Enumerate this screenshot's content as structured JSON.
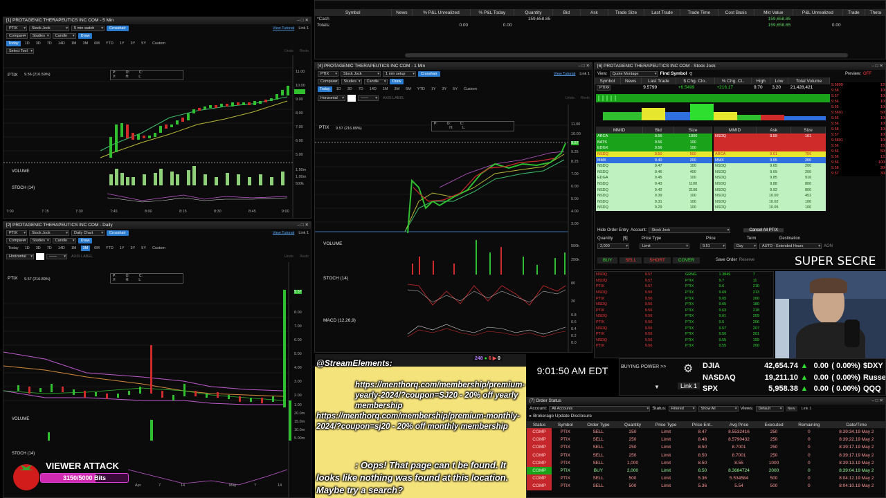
{
  "w1": {
    "title": "[1] PROTAGENIC THERAPEUTICS INC COM - 5 Min",
    "symbol": "PTIX",
    "layout": "Stock Jock",
    "interval": "5 min watch",
    "crosshair": "Crosshair",
    "tutorial": "View Tutorial",
    "link": "Link 1",
    "compare": "Compare",
    "studies": "Studies",
    "candle": "Candle",
    "draw": "Draw",
    "periods": [
      "Today",
      "1D",
      "3D",
      "7D",
      "14D",
      "1M",
      "3M",
      "6M",
      "YTD",
      "1Y",
      "3Y",
      "5Y",
      "Custom"
    ],
    "tool": "Select Tool",
    "undo": "Undo",
    "redo": "Redo",
    "price_label": "PTIX",
    "price_tag": "9.56 (216.59%)",
    "ohlc": [
      "P:",
      "O:",
      "C:",
      "V:",
      "H:",
      "L:"
    ],
    "volume": "VOLUME",
    "stoch": "STOCH (14)",
    "xticks": [
      "7:00",
      "7:15",
      "7:30",
      "7:45",
      "8:00",
      "8:15",
      "8:30",
      "8:45",
      "9:00"
    ],
    "yticks": [
      "11.00",
      "10.00",
      "9.00",
      "8.00",
      "7.00",
      "6.00",
      "5.00",
      "4.00",
      "3.00"
    ],
    "vticks": [
      "1.50m",
      "1.00m",
      "500k"
    ]
  },
  "w2": {
    "title": "[2] PROTAGENIC THERAPEUTICS INC COM - Daily",
    "symbol": "PTIX",
    "layout": "Stock Jock",
    "interval": "Daily Chart",
    "crosshair": "Crosshair",
    "tutorial": "View Tutorial",
    "link": "Link 1",
    "compare": "Compare",
    "studies": "Studies",
    "candle": "Candle",
    "draw": "Draw",
    "periods": [
      "Today",
      "1D",
      "3D",
      "7D",
      "14D",
      "1M",
      "3M",
      "6M",
      "YTD",
      "1Y",
      "3Y",
      "5Y",
      "Custom"
    ],
    "tool": "Horizontal",
    "axis": "AXIS LABEL",
    "undo": "Undo",
    "redo": "Redo",
    "price_label": "PTIX",
    "price_tag": "9.57 (216.89%)",
    "ohlc": [
      "P:",
      "O:",
      "C:",
      "V:",
      "H:",
      "L:"
    ],
    "volume": "VOLUME",
    "stoch": "STOCH (14)",
    "xticks": [
      "Apr",
      "7",
      "14",
      "May",
      "7",
      "14"
    ],
    "yticks": [
      "9.57",
      "8.00",
      "7.00",
      "6.00",
      "5.00",
      "4.00",
      "3.00",
      "2.00",
      "1.00"
    ],
    "vticks": [
      "20.0m",
      "15.0m",
      "10.0m",
      "5.00m"
    ]
  },
  "w4": {
    "title": "[4] PROTAGENIC THERAPEUTICS INC COM - 1 Min",
    "symbol": "PTIX",
    "layout": "Stock Jock",
    "interval": "1 min setup",
    "crosshair": "Crosshair",
    "tutorial": "View Tutorial",
    "link": "Link 1",
    "compare": "Compare",
    "studies": "Studies",
    "candle": "Candle",
    "draw": "Draw",
    "periods": [
      "Today",
      "1D",
      "3D",
      "7D",
      "14D",
      "1M",
      "3M",
      "6M",
      "YTD",
      "1Y",
      "3Y",
      "5Y",
      "Custom"
    ],
    "tool": "Horizontal",
    "axis": "AXIS LABEL",
    "undo": "Undo",
    "redo": "Redo",
    "price_label": "PTIX",
    "price_tag": "9.57 (216.89%)",
    "ohlc": [
      "P:",
      "O:",
      "C:",
      "H:",
      "L:"
    ],
    "volume": "VOLUME",
    "stoch": "STOCH (14)",
    "macd": "MACD (12,26,9)",
    "yticks": [
      "11.00",
      "10.00",
      "9.57",
      "9.25",
      "8.25",
      "7.00",
      "6.00",
      "5.00",
      "4.00",
      "3.00"
    ],
    "vticks": [
      "500k",
      "250k"
    ],
    "sticks": [
      "80",
      "20"
    ],
    "mticks": [
      "0.8",
      "0.6",
      "0.4",
      "0.2",
      "0.0"
    ]
  },
  "portfolio": {
    "headers": [
      "Symbol",
      "News",
      "% P&L Unrealized",
      "% P&L Today",
      "Quantity",
      "Bid",
      "Ask",
      "Trade Size",
      "Last Trade",
      "Trade Time",
      "Cost Basis",
      "Mkt Value",
      "P&L Unrealized",
      "Trade",
      "Theta"
    ],
    "rows": [
      [
        "*Cash",
        "",
        "",
        "",
        "159,658.85",
        "",
        "",
        "",
        "",
        "",
        "",
        "159,658.85",
        "",
        "",
        ""
      ],
      [
        "Totals:",
        "",
        "0.00",
        "0.00",
        "",
        "",
        "",
        "",
        "",
        "",
        "",
        "159,658.85",
        "0.00",
        "",
        ""
      ]
    ]
  },
  "quote": {
    "title": "[6] PROTAGENIC THERAPEUTICS INC COM - Stock Jock",
    "view": "View:",
    "montage": "Quote Montage",
    "find": "Find Symbol",
    "preview": "Preview:",
    "preview_state": "OFF",
    "headers": [
      "Symbol",
      "News",
      "Last Trade",
      "$ Chg. Clo..",
      "% Chg. Cl..",
      "High",
      "Low",
      "Total Volume"
    ],
    "row": [
      "PTIX",
      "",
      "9.5799",
      "+6.5499",
      "+216.17",
      "9.70",
      "3.20",
      "21,428,421"
    ]
  },
  "level2": {
    "bid_headers": [
      "MMID",
      "Bid",
      "Size"
    ],
    "ask_headers": [
      "MMID",
      "Ask",
      "Size"
    ],
    "bids": [
      [
        "ARCA",
        "9.56",
        "1800"
      ],
      [
        "BATS",
        "9.56",
        "100"
      ],
      [
        "EDGX",
        "9.56",
        "100"
      ],
      [
        "NSDQ",
        "9.50",
        "500"
      ],
      [
        "MMX",
        "9.40",
        "200"
      ],
      [
        "NSDQ",
        "9.47",
        "100"
      ],
      [
        "NSDQ",
        "9.46",
        "400"
      ],
      [
        "EDGA",
        "9.45",
        "100"
      ],
      [
        "NSDQ",
        "9.43",
        "1100"
      ],
      [
        "NSDQ",
        "9.42",
        "2100"
      ],
      [
        "NSDQ",
        "9.39",
        "100"
      ],
      [
        "NSDQ",
        "9.31",
        "100"
      ],
      [
        "NSDQ",
        "9.29",
        "100"
      ]
    ],
    "asks": [
      [
        "NSDQ",
        "9.59",
        "161"
      ],
      [
        "",
        "",
        ""
      ],
      [
        "",
        "",
        ""
      ],
      [
        "ARCA",
        "9.61",
        "700"
      ],
      [
        "MMX",
        "9.65",
        "200"
      ],
      [
        "NSDQ",
        "9.65",
        "200"
      ],
      [
        "NSDQ",
        "9.69",
        "200"
      ],
      [
        "NSDQ",
        "9.85",
        "916"
      ],
      [
        "NSDQ",
        "9.88",
        "800"
      ],
      [
        "NSDQ",
        "9.92",
        "800"
      ],
      [
        "NSDQ",
        "10.00",
        "452"
      ],
      [
        "NSDQ",
        "10.02",
        "100"
      ],
      [
        "NSDQ",
        "10.05",
        "100"
      ]
    ],
    "right_prices": [
      "9.5899",
      "9.58",
      "9.57",
      "9.56",
      "9.55",
      "9.5601",
      "9.56",
      "9.56",
      "9.58",
      "9.57",
      "9.5801",
      "9.56",
      "9.56",
      "9.56",
      "9.56",
      "9.58",
      "9.57"
    ],
    "right_sizes": [
      "120",
      "100",
      "100",
      "100",
      "100",
      "500",
      "100",
      "100",
      "100",
      "100",
      "100",
      "150",
      "500",
      "131",
      "1000",
      "300",
      "300"
    ]
  },
  "order_entry": {
    "hide": "Hide Order Entry",
    "account_label": "Account:",
    "account": "Stock Jock",
    "cancel": "Cancel All PTIX",
    "labels": [
      "Quantity",
      "[$]",
      "Price Type",
      "Price",
      "Term",
      "Destination"
    ],
    "quantity": "2,000",
    "price_type": "Limit",
    "price": "9.51",
    "term": "Day",
    "destination": "AUTO - Extended Hours",
    "aon": "AON",
    "actions": [
      "BUY",
      "SELL",
      "SHORT",
      "COVER"
    ],
    "save": "Save Order",
    "reserve": "Reserve"
  },
  "tape": {
    "left": [
      [
        "NSDQ",
        "9.57"
      ],
      [
        "NSDQ",
        "9.57"
      ],
      [
        "PTIX",
        "9.57"
      ],
      [
        "NSDQ",
        "9.56"
      ],
      [
        "PTIX",
        "9.56"
      ],
      [
        "NSDQ",
        "9.56"
      ],
      [
        "PTIX",
        "9.56"
      ],
      [
        "NSDQ",
        "9.56"
      ],
      [
        "PTIX",
        "9.56"
      ],
      [
        "NSDQ",
        "9.56"
      ],
      [
        "PTIX",
        "9.56"
      ],
      [
        "NSDQ",
        "9.56"
      ],
      [
        "PTIX",
        "9.56"
      ]
    ],
    "right": [
      [
        "GRNG",
        "1.3849",
        "7"
      ],
      [
        "PTIX",
        "9.7",
        "11"
      ],
      [
        "PTIX",
        "9.6",
        "210"
      ],
      [
        "PTIX",
        "9.69",
        "213"
      ],
      [
        "PTIX",
        "9.65",
        "200"
      ],
      [
        "PTIX",
        "9.65",
        "180"
      ],
      [
        "PTIX",
        "9.63",
        "218"
      ],
      [
        "PTIX",
        "9.61",
        "209"
      ],
      [
        "PTIX",
        "9.5",
        "206"
      ],
      [
        "PTIX",
        "9.57",
        "207"
      ],
      [
        "PTIX",
        "9.56",
        "201"
      ],
      [
        "PTIX",
        "9.55",
        "199"
      ],
      [
        "PTIX",
        "9.55",
        "200"
      ]
    ]
  },
  "market": {
    "buying_power": "BUYING POWER >>",
    "link": "Link 1",
    "rows": [
      [
        "DJIA",
        "42,654.74",
        "0.00",
        "( 0.00%)",
        "$DXY"
      ],
      [
        "NASDAQ",
        "19,211.10",
        "0.00",
        "( 0.00%)",
        "Russe"
      ],
      [
        "SPX",
        "5,958.38",
        "0.00",
        "( 0.00%)",
        "QQQ"
      ]
    ]
  },
  "orders": {
    "title": "[7] Order Status",
    "account_label": "Account:",
    "account": "All Accounts",
    "status_label": "Status:",
    "status": "Filtered",
    "show": "Show All",
    "views_label": "Views:",
    "views": "Default",
    "new": "New",
    "link": "Link 1",
    "disclosure": "Brokerage Update Disclosure",
    "headers": [
      "Status",
      "Symbol",
      "Order Type",
      "Quantity",
      "Price Type",
      "Price Ent..",
      "Avg Price",
      "Executed",
      "Remaining",
      "Date/Time"
    ],
    "rows": [
      [
        "COMP",
        "PTIX",
        "SELL",
        "250",
        "Limit",
        "8.47",
        "8.5532416",
        "250",
        "0",
        "8:39:34.19 May 2"
      ],
      [
        "COMP",
        "PTIX",
        "SELL",
        "250",
        "Limit",
        "8.48",
        "8.5790432",
        "250",
        "0",
        "8:39:22.19 May 2"
      ],
      [
        "COMP",
        "PTIX",
        "SELL",
        "250",
        "Limit",
        "8.50",
        "8.7001",
        "250",
        "0",
        "8:39:17.19 May 2"
      ],
      [
        "COMP",
        "PTIX",
        "SELL",
        "250",
        "Limit",
        "8.50",
        "8.7001",
        "250",
        "0",
        "8:39:17.19 May 2"
      ],
      [
        "COMP",
        "PTIX",
        "SELL",
        "1,000",
        "Limit",
        "8.50",
        "8.55",
        "1000",
        "0",
        "8:39:13.19 May 2"
      ],
      [
        "COMP",
        "PTIX",
        "BUY",
        "2,000",
        "Limit",
        "8.50",
        "8.3684724",
        "2000",
        "0",
        "8:39:04.19 May 2"
      ],
      [
        "COMP",
        "PTIX",
        "SELL",
        "500",
        "Limit",
        "5.36",
        "5.534584",
        "500",
        "0",
        "8:04:12.19 May 2"
      ],
      [
        "COMP",
        "PTIX",
        "SELL",
        "500",
        "Limit",
        "5.36",
        "5.54",
        "500",
        "0",
        "8:04:10.19 May 2"
      ]
    ]
  },
  "stream": {
    "handle": "@StreamElements:",
    "link1": "https://menthorq.com/membership/premium-yearly-2024/?coupon=SJ20 - 20% off yearly membership",
    "link2": "https://menthorq.com/membership/premium-monthly-2024/?coupon=sj20 - 20% off monthly membership",
    "msg": ": Oops! That page can t be found. It looks like nothing was found at this location. Maybe try a search?",
    "clock": "9:01:50 AM EDT",
    "secret": "SUPER SECRE",
    "badges": [
      "248",
      "6",
      "0"
    ]
  },
  "bits": {
    "title": "VIEWER ATTACK",
    "progress": "3150/5000 Bits",
    "value": 3150,
    "max": 5000
  }
}
